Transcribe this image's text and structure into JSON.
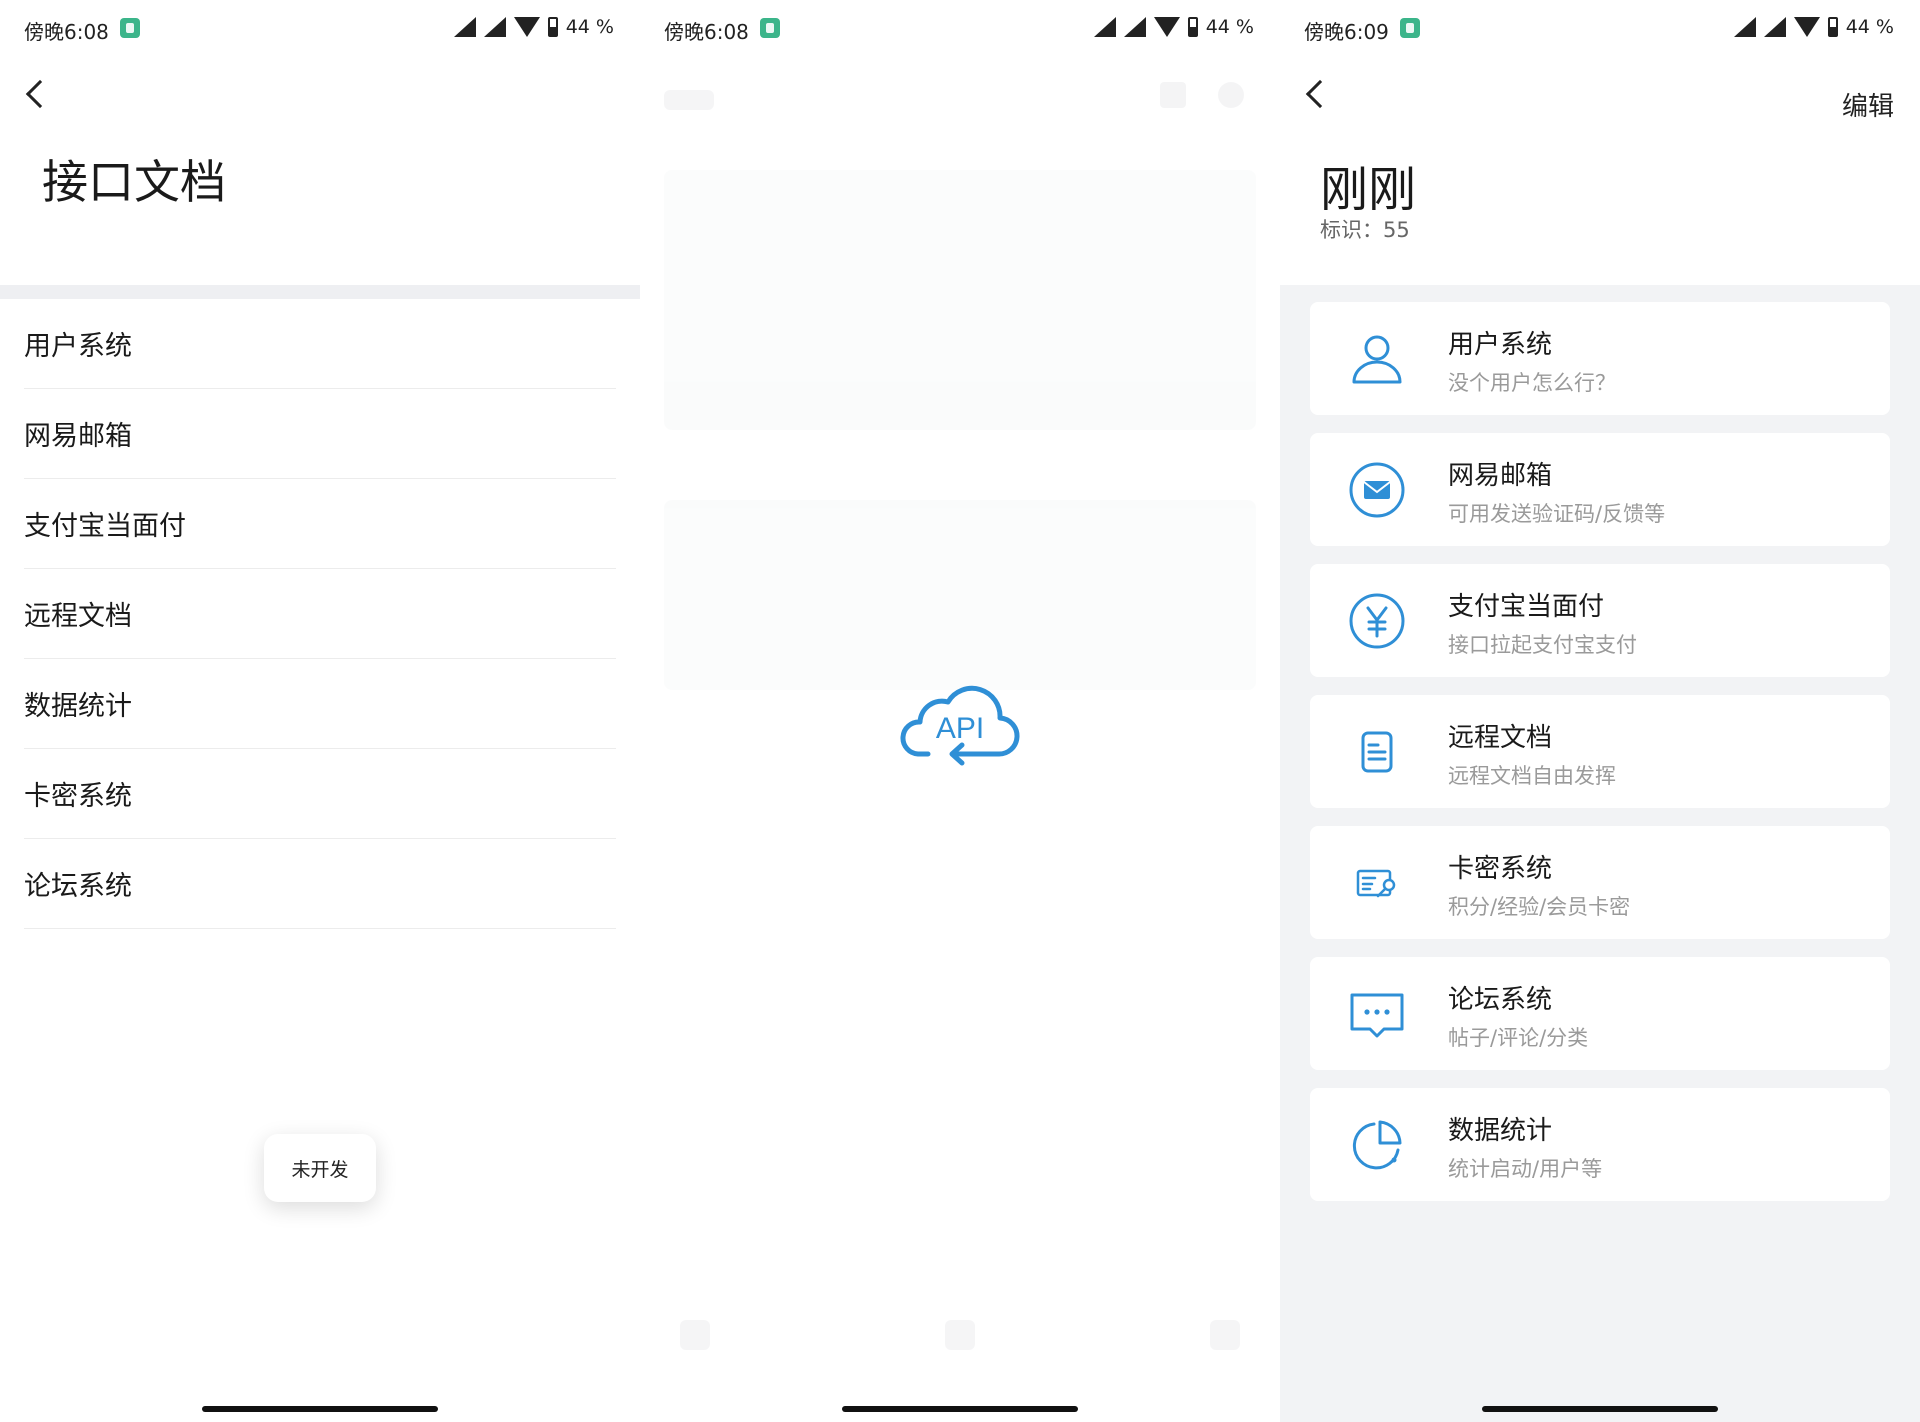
{
  "status_bars": [
    {
      "time": "傍晚6:08",
      "battery": "44 %"
    },
    {
      "time": "傍晚6:08",
      "battery": "44 %"
    },
    {
      "time": "傍晚6:09",
      "battery": "44 %"
    }
  ],
  "panel1": {
    "title": "接口文档",
    "items": [
      "用户系统",
      "网易邮箱",
      "支付宝当面付",
      "远程文档",
      "数据统计",
      "卡密系统",
      "论坛系统"
    ],
    "toast": "未开发"
  },
  "panel2": {
    "logo_text": "API",
    "accent": "#2f8fd6"
  },
  "panel3": {
    "title": "刚刚",
    "ident": "标识：55",
    "edit_label": "编辑",
    "cards": [
      {
        "title": "用户系统",
        "subtitle": "没个用户怎么行？",
        "icon": "user-icon"
      },
      {
        "title": "网易邮箱",
        "subtitle": "可用发送验证码/反馈等",
        "icon": "mail-icon"
      },
      {
        "title": "支付宝当面付",
        "subtitle": "接口拉起支付宝支付",
        "icon": "yen-icon"
      },
      {
        "title": "远程文档",
        "subtitle": "远程文档自由发挥",
        "icon": "document-icon"
      },
      {
        "title": "卡密系统",
        "subtitle": "积分/经验/会员卡密",
        "icon": "card-key-icon"
      },
      {
        "title": "论坛系统",
        "subtitle": "帖子/评论/分类",
        "icon": "chat-icon"
      },
      {
        "title": "数据统计",
        "subtitle": "统计启动/用户等",
        "icon": "pie-chart-icon"
      }
    ],
    "accent": "#2f8fd6"
  }
}
